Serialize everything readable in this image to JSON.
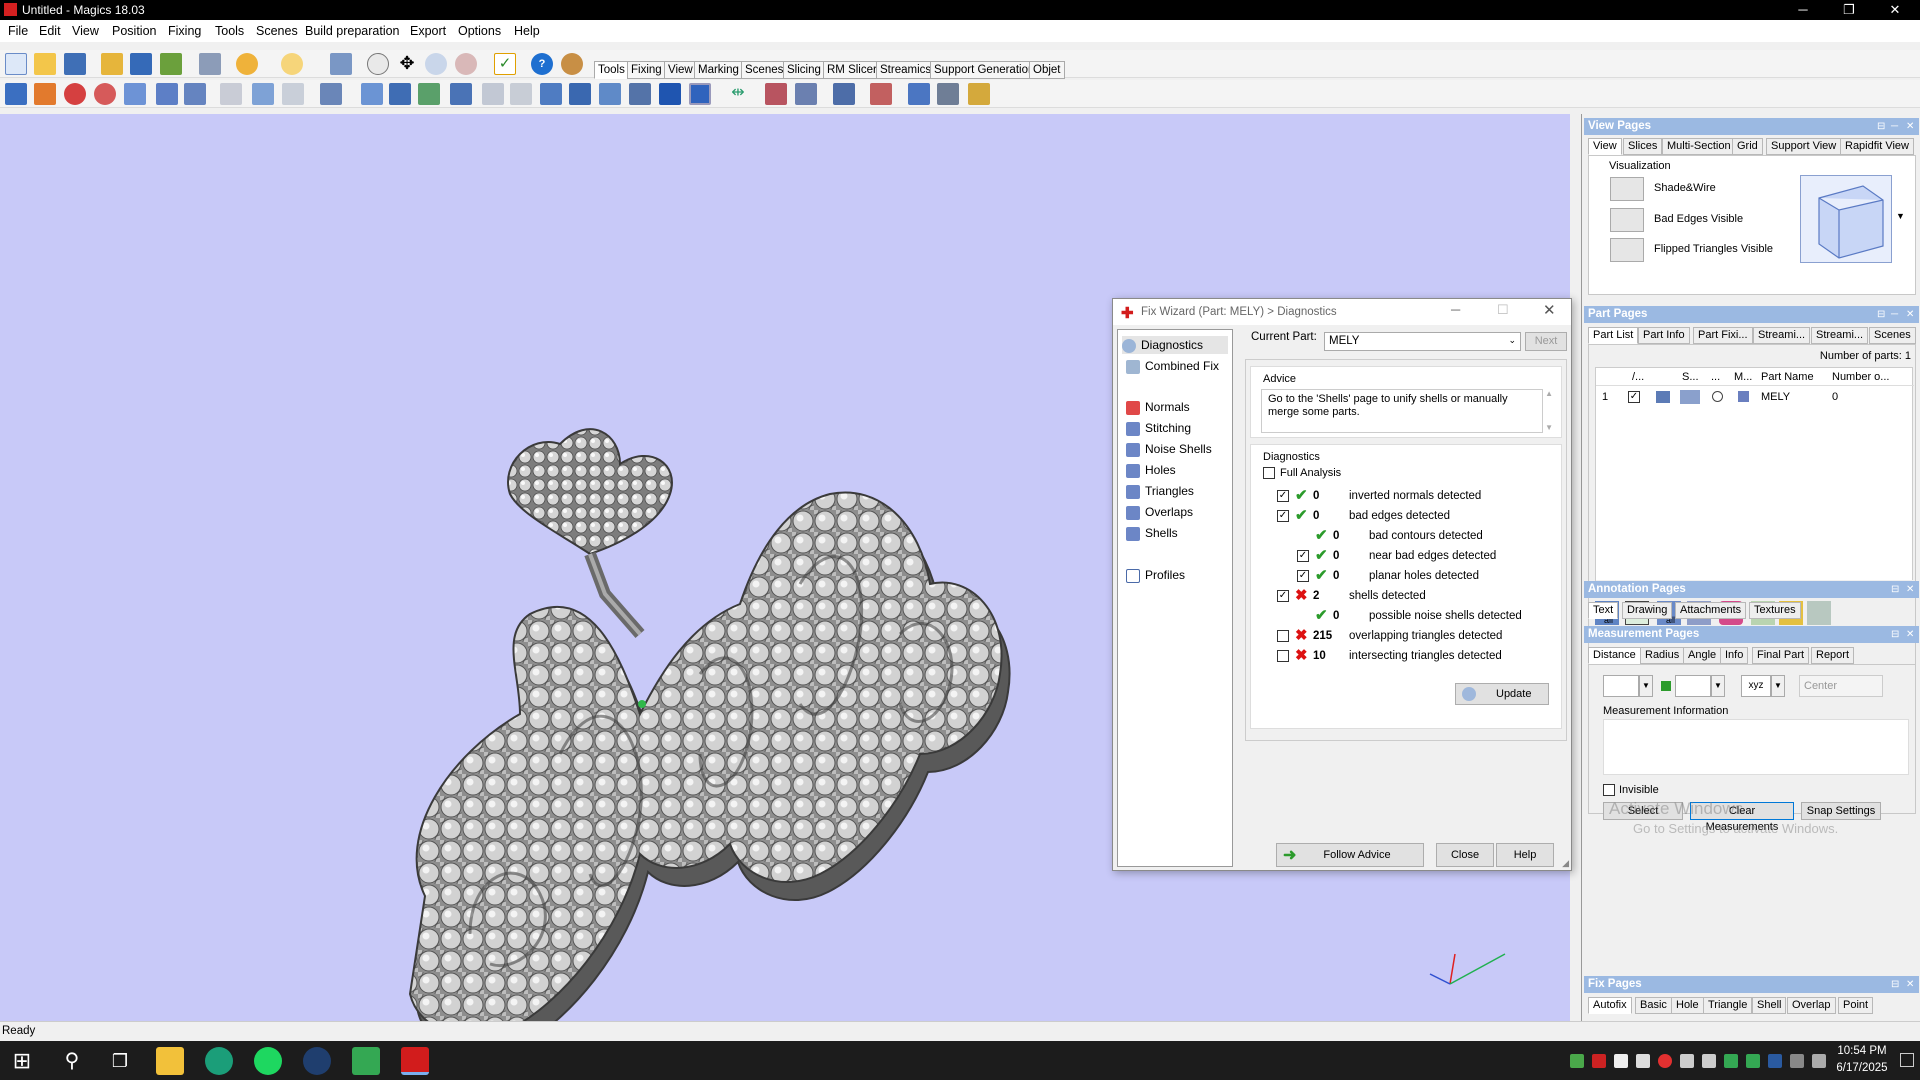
{
  "window": {
    "title": "Untitled - Magics 18.03",
    "min": "─",
    "max": "❐",
    "close": "✕"
  },
  "menu": [
    "File",
    "Edit",
    "View",
    "Position",
    "Fixing",
    "Tools",
    "Scenes",
    "Build preparation",
    "Export",
    "Options",
    "Help"
  ],
  "toolbar_tabs": [
    "Tools",
    "Fixing",
    "View",
    "Marking",
    "Scenes",
    "Slicing",
    "RM Slicer",
    "Streamics",
    "Support Generation",
    "Objet"
  ],
  "view_pages": {
    "title": "View Pages",
    "tabs": [
      "View",
      "Slices",
      "Multi-Section",
      "Grid",
      "Support View",
      "Rapidfit View"
    ],
    "group": "Visualization",
    "items": [
      "Shade&Wire",
      "Bad Edges Visible",
      "Flipped Triangles Visible"
    ]
  },
  "part_pages": {
    "title": "Part Pages",
    "tabs": [
      "Part List",
      "Part Info",
      "Part Fixi...",
      "Streami...",
      "Streami...",
      "Scenes"
    ],
    "count_label": "Number of parts: 1",
    "columns": [
      "/...",
      "S...",
      "...",
      "M...",
      "Part Name",
      "Number o..."
    ],
    "row": {
      "index": "1",
      "name": "MELY",
      "number": "0"
    },
    "icon_label_all": "all"
  },
  "annotation_pages": {
    "title": "Annotation Pages",
    "tabs": [
      "Text",
      "Drawing",
      "Attachments",
      "Textures"
    ]
  },
  "measurement_pages": {
    "title": "Measurement Pages",
    "tabs": [
      "Distance",
      "Radius",
      "Angle",
      "Info",
      "Final Part",
      "Report"
    ],
    "xyz": "xyz",
    "center": "Center",
    "info_label": "Measurement Information",
    "invisible": "Invisible",
    "select": "Select",
    "clear": "Clear Measurements",
    "snap": "Snap Settings",
    "watermark1": "Activate Windows",
    "watermark2": "Go to Settings to activate Windows."
  },
  "fix_pages": {
    "title": "Fix Pages",
    "tabs": [
      "Autofix",
      "Basic",
      "Hole",
      "Triangle",
      "Shell",
      "Overlap",
      "Point"
    ]
  },
  "dialog": {
    "title": "Fix Wizard (Part: MELY) > Diagnostics",
    "nav": [
      "Diagnostics",
      "Combined Fix",
      "Normals",
      "Stitching",
      "Noise Shells",
      "Holes",
      "Triangles",
      "Overlaps",
      "Shells",
      "Profiles"
    ],
    "current_part_label": "Current Part:",
    "current_part": "MELY",
    "next": "Next",
    "advice_title": "Advice",
    "advice_text": "Go to the 'Shells' page to unify shells or manually merge some parts.",
    "diag_title": "Diagnostics",
    "full_analysis": "Full Analysis",
    "rows": [
      {
        "checked": true,
        "ok": true,
        "value": "0",
        "label": "inverted normals detected",
        "indent": 0
      },
      {
        "checked": true,
        "ok": true,
        "value": "0",
        "label": "bad edges detected",
        "indent": 0
      },
      {
        "checked": null,
        "ok": true,
        "value": "0",
        "label": "bad contours detected",
        "indent": 1
      },
      {
        "checked": true,
        "ok": true,
        "value": "0",
        "label": "near bad edges detected",
        "indent": 1
      },
      {
        "checked": true,
        "ok": true,
        "value": "0",
        "label": "planar holes detected",
        "indent": 1
      },
      {
        "checked": true,
        "ok": false,
        "value": "2",
        "label": "shells detected",
        "indent": 0
      },
      {
        "checked": null,
        "ok": true,
        "value": "0",
        "label": "possible noise shells detected",
        "indent": 1
      },
      {
        "checked": false,
        "ok": false,
        "value": "215",
        "label": "overlapping triangles detected",
        "indent": 0
      },
      {
        "checked": false,
        "ok": false,
        "value": "10",
        "label": "intersecting triangles detected",
        "indent": 0
      }
    ],
    "update": "Update",
    "follow_advice": "Follow Advice",
    "close": "Close",
    "help": "Help"
  },
  "status": "Ready",
  "clock": {
    "time": "10:54 PM",
    "date": "6/17/2025"
  }
}
